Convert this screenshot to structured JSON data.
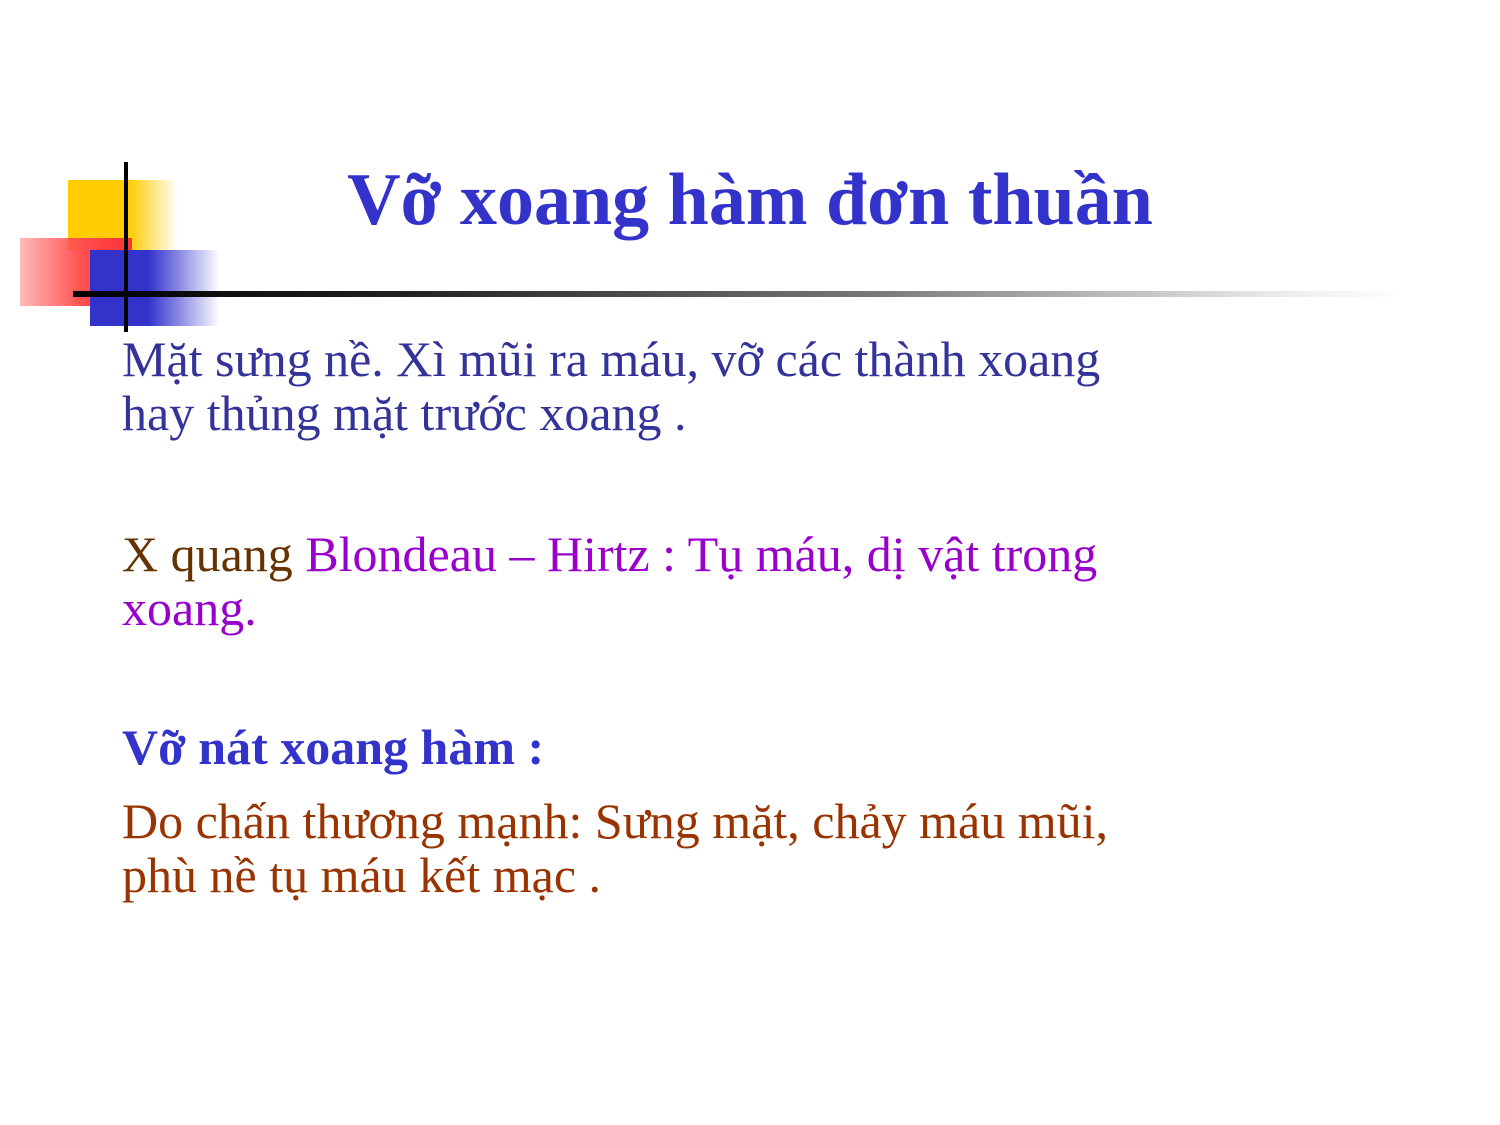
{
  "slide": {
    "title": "Vỡ xoang hàm đơn thuần",
    "paragraph1": {
      "line1": "Mặt sưng nề. Xì mũi ra máu, vỡ các thành xoang",
      "line2": "hay thủng mặt trước xoang ."
    },
    "paragraph2": {
      "prefix": "X quang ",
      "line1_rest": "Blondeau – Hirtz : Tụ máu, dị vật trong",
      "line2": "xoang."
    },
    "heading2": "Vỡ nát xoang hàm :",
    "paragraph4": {
      "line1": "Do chấn thương mạnh: Sưng mặt, chảy máu mũi,",
      "line2": "phù nề tụ máu kết mạc ."
    }
  },
  "colors": {
    "title": "#3333cc",
    "paragraph1": "#333399",
    "xquang": "#663300",
    "blondeau": "#9900cc",
    "heading2": "#3333cc",
    "paragraph4": "#993300",
    "deco_yellow": "#ffcc00",
    "deco_red": "#ff5050",
    "deco_blue": "#3333cc"
  }
}
